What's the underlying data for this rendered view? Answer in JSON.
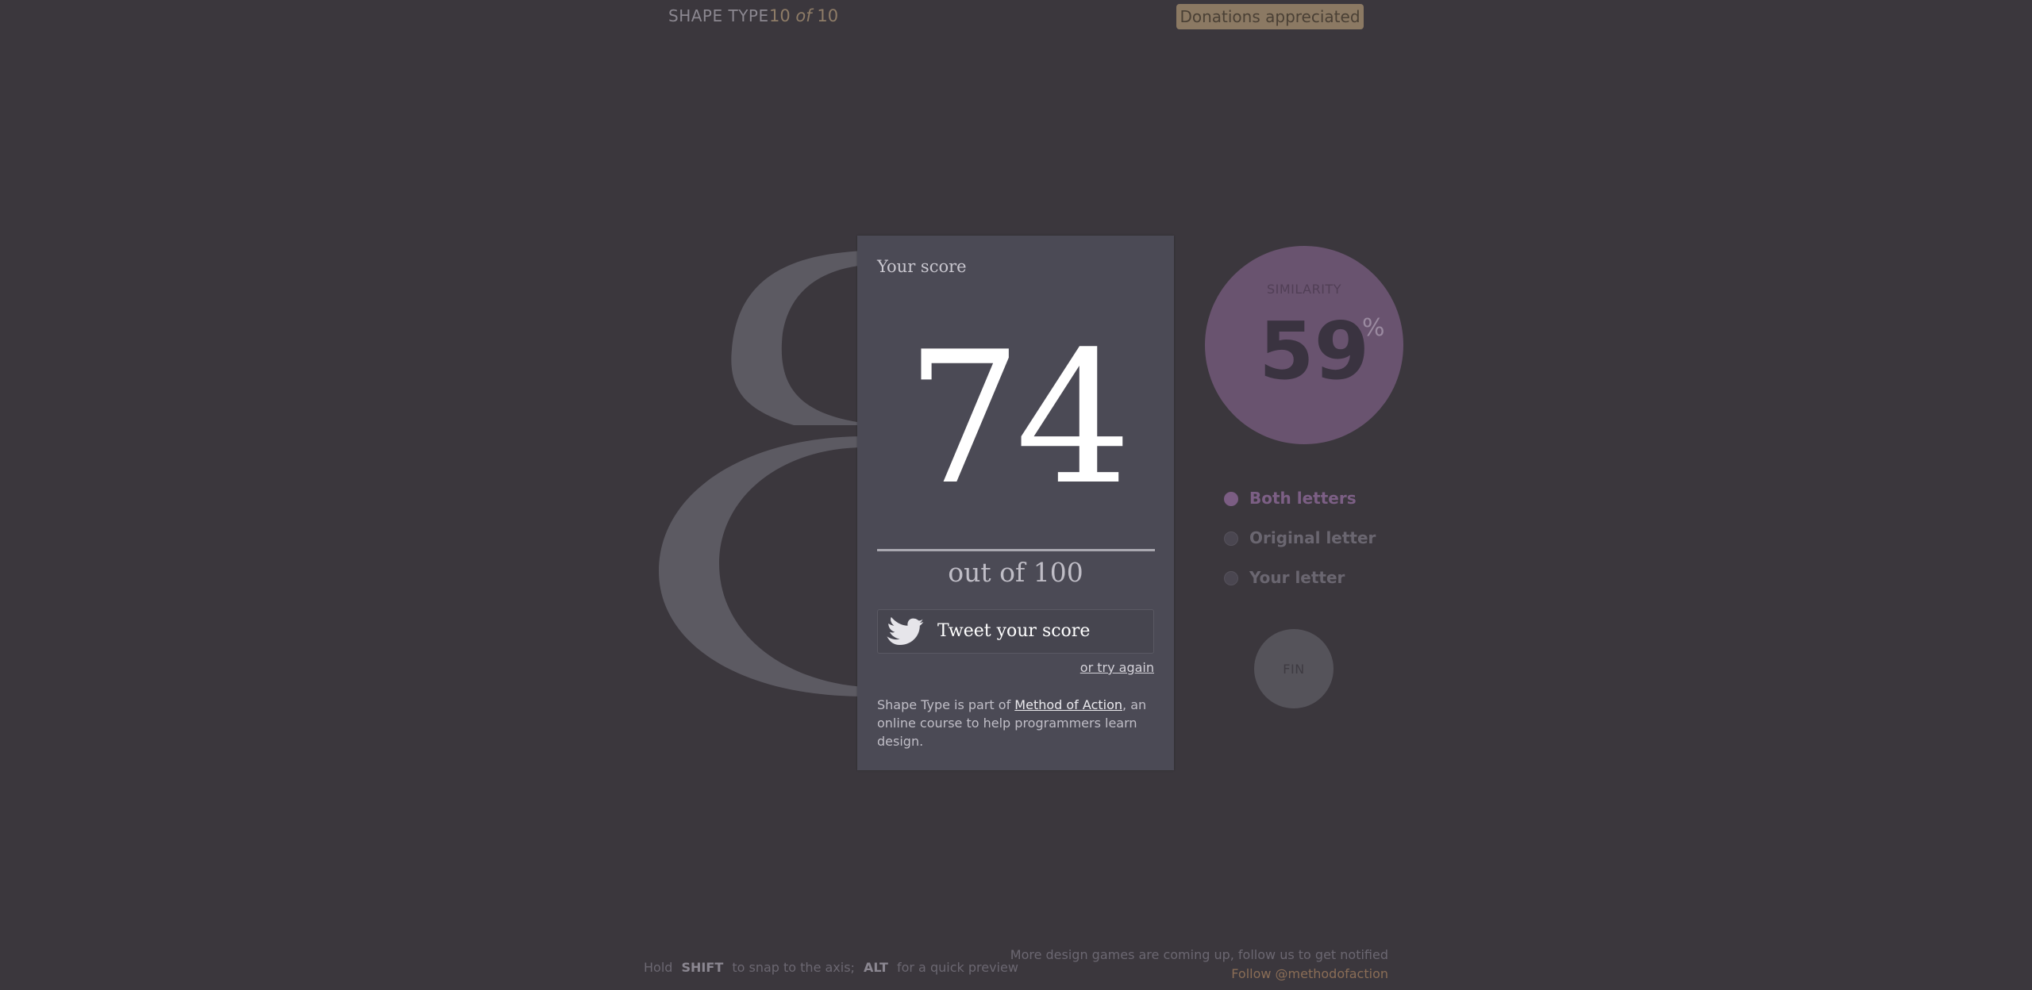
{
  "header": {
    "app_title": "SHAPE TYPE",
    "progress_current": "10",
    "progress_of": "of",
    "progress_total": "10",
    "donate_label": "Donations appreciated"
  },
  "glyph": {
    "character": "8",
    "color": "#5c5a62"
  },
  "score_card": {
    "heading": "Your score",
    "score": "74",
    "out_of": "out of 100",
    "tweet_label": "Tweet your score",
    "try_again": "or try again",
    "footer_prefix": "Shape Type is part of ",
    "footer_link": "Method of Action",
    "footer_suffix": ", an online course to help programmers learn design."
  },
  "similarity": {
    "label": "SIMILARITY",
    "value": "59",
    "unit": "%",
    "color": "#69536f"
  },
  "options": [
    {
      "label": "Both letters",
      "selected": true
    },
    {
      "label": "Original letter",
      "selected": false
    },
    {
      "label": "Your letter",
      "selected": false
    }
  ],
  "fin_label": "FIN",
  "hints": {
    "hold": "Hold",
    "shift_key": "SHIFT",
    "shift_desc": "to snap to the axis;",
    "alt_key": "ALT",
    "alt_desc": "for a quick preview"
  },
  "notify": {
    "line1": "More design games are coming up, follow us to get notified",
    "follow": "Follow @methodofaction"
  }
}
